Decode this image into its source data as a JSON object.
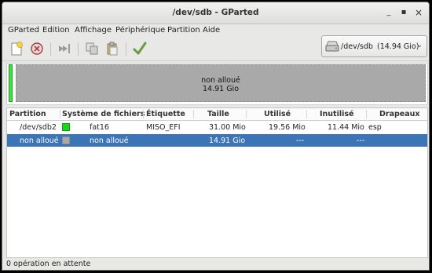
{
  "window": {
    "title": "/dev/sdb - GParted"
  },
  "window_buttons": {
    "minimize": "_",
    "maximize": "▪",
    "close": "×"
  },
  "menu": [
    "GParted",
    "Edition",
    "Affichage",
    "Périphérique",
    "Partition",
    "Aide"
  ],
  "toolbar_icons": [
    "new-icon",
    "delete-icon",
    "resize-move-icon",
    "copy-icon",
    "paste-icon",
    "apply-icon"
  ],
  "device_selector": {
    "name": "/dev/sdb",
    "size": "(14.94 Gio)",
    "icon": "drive-icon"
  },
  "disk_map": {
    "label": "non alloué",
    "size": "14.91 Gio",
    "used_color": "#3fe33f",
    "unallocated_color": "#a9a9a9"
  },
  "columns": [
    "Partition",
    "Système de fichiers",
    "Étiquette",
    "Taille",
    "Utilisé",
    "Inutilisé",
    "Drapeaux"
  ],
  "rows": [
    {
      "partition": "/dev/sdb2",
      "fs": "fat16",
      "fs_color": "#18d818",
      "label": "MISO_EFI",
      "size": "31.00 Mio",
      "used": "19.56 Mio",
      "unused": "11.44 Mio",
      "flags": "esp",
      "selected": false
    },
    {
      "partition": "non alloué",
      "fs": "non alloué",
      "fs_color": "#a9a9a9",
      "label": "",
      "size": "14.91 Gio",
      "used": "---",
      "unused": "---",
      "flags": "",
      "selected": true
    }
  ],
  "status": "0 opération en attente",
  "colors": {
    "selection": "#3b75b7"
  }
}
